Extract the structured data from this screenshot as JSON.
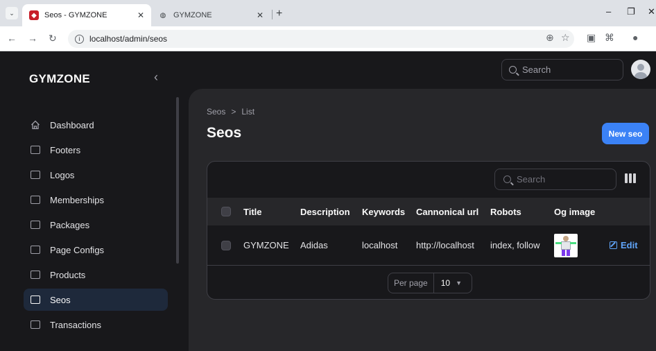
{
  "browser": {
    "tabs": [
      {
        "title": "Seos - GYMZONE",
        "active": true,
        "favicon": "app-favicon-icon"
      },
      {
        "title": "GYMZONE",
        "active": false,
        "favicon": "globe-icon"
      }
    ],
    "url": "localhost/admin/seos"
  },
  "brand": "GYMZONE",
  "search": {
    "placeholder": "Search"
  },
  "sidebar": {
    "items": [
      {
        "label": "Dashboard",
        "icon": "home-icon",
        "active": false
      },
      {
        "label": "Footers",
        "icon": "rectangle-stack-icon",
        "active": false
      },
      {
        "label": "Logos",
        "icon": "rectangle-stack-icon",
        "active": false
      },
      {
        "label": "Memberships",
        "icon": "rectangle-stack-icon",
        "active": false
      },
      {
        "label": "Packages",
        "icon": "rectangle-stack-icon",
        "active": false
      },
      {
        "label": "Page Configs",
        "icon": "rectangle-stack-icon",
        "active": false
      },
      {
        "label": "Products",
        "icon": "rectangle-stack-icon",
        "active": false
      },
      {
        "label": "Seos",
        "icon": "rectangle-stack-icon",
        "active": true
      },
      {
        "label": "Transactions",
        "icon": "rectangle-stack-icon",
        "active": false
      }
    ]
  },
  "page": {
    "breadcrumb": [
      "Seos",
      "List"
    ],
    "breadcrumb_sep": ">",
    "title": "Seos",
    "new_button": "New seo"
  },
  "table": {
    "search_placeholder": "Search",
    "columns": [
      "Title",
      "Description",
      "Keywords",
      "Cannonical url",
      "Robots",
      "Og image"
    ],
    "rows": [
      {
        "title": "GYMZONE",
        "description": "Adidas",
        "keywords": "localhost",
        "cannonical_url": "http://localhost",
        "robots": "index, follow",
        "og_image": "action-figure-thumbnail",
        "action": "Edit"
      }
    ],
    "pagination": {
      "label": "Per page",
      "value": "10"
    }
  },
  "colors": {
    "accent": "#3b82f6",
    "link": "#60a5fa",
    "background": "#18181b",
    "panel": "#27272a",
    "active_nav": "#1e293b"
  }
}
